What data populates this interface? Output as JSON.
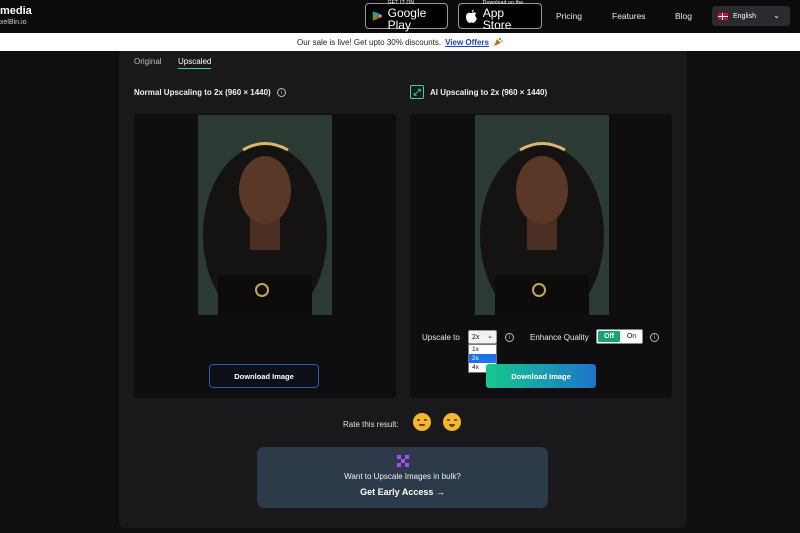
{
  "header": {
    "brand_line1": "media",
    "brand_line2": "xelBin.io",
    "google_play": {
      "small": "GET IT ON",
      "big": "Google Play"
    },
    "app_store": {
      "small": "Download on the",
      "big": "App Store"
    },
    "nav": [
      "Pricing",
      "Features",
      "Blog"
    ],
    "language": "English"
  },
  "banner": {
    "text": "Our sale is live! Get upto 30% discounts.",
    "link": "View Offers"
  },
  "tabs": [
    "Original",
    "Upscaled"
  ],
  "active_tab": "Upscaled",
  "left": {
    "title": "Normal Upscaling to 2x (960 × 1440)",
    "button": "Download Image"
  },
  "right": {
    "title": "AI Upscaling to 2x (960 × 1440)",
    "upscale_label": "Upscale to",
    "upscale_value": "2x",
    "upscale_options": [
      "1x",
      "2x",
      "4x"
    ],
    "enhance_label": "Enhance Quality",
    "toggle_off": "Off",
    "toggle_on": "On",
    "button": "Download Image"
  },
  "rate": {
    "label": "Rate this result:"
  },
  "promo": {
    "question": "Want to Upscale Images in bulk?",
    "cta": "Get Early Access →"
  },
  "colors": {
    "accent": "#3ed3a5",
    "panel": "#19191b",
    "promo": "#2d3a4a",
    "selected": "#1e73e8"
  }
}
